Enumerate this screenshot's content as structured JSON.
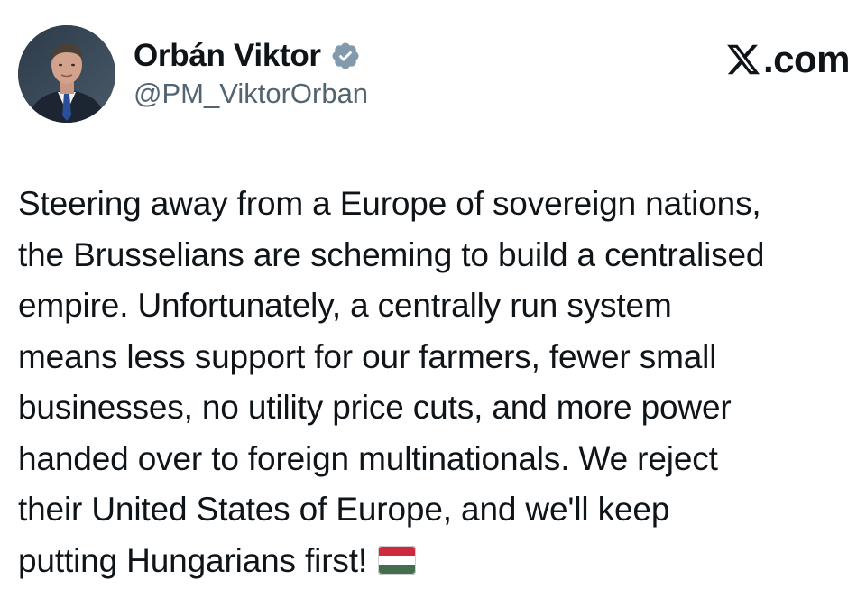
{
  "author": {
    "display_name": "Orbán Viktor",
    "handle": "@PM_ViktorOrban",
    "verified_icon": "verified-badge-icon",
    "avatar_icon": "avatar-portrait"
  },
  "brand": {
    "logo_icon": "x-logo-icon",
    "text": ".com"
  },
  "post": {
    "lines": [
      "Steering away from a Europe of sovereign nations,",
      "the Brusselians are scheming to build a centralised",
      "empire. Unfortunately, a centrally run system",
      "means less support for our farmers, fewer small",
      "businesses, no utility price cuts, and more power",
      "handed over to foreign multinationals. We reject",
      "their United States of Europe, and we'll keep",
      "putting Hungarians first!"
    ],
    "emoji_icon": "hungary-flag-icon"
  },
  "colors": {
    "text": "#0f1419",
    "secondary": "#536471",
    "verified": "#829aab",
    "flag_red": "#cd2a3e",
    "flag_white": "#ffffff",
    "flag_green": "#436f4d"
  }
}
